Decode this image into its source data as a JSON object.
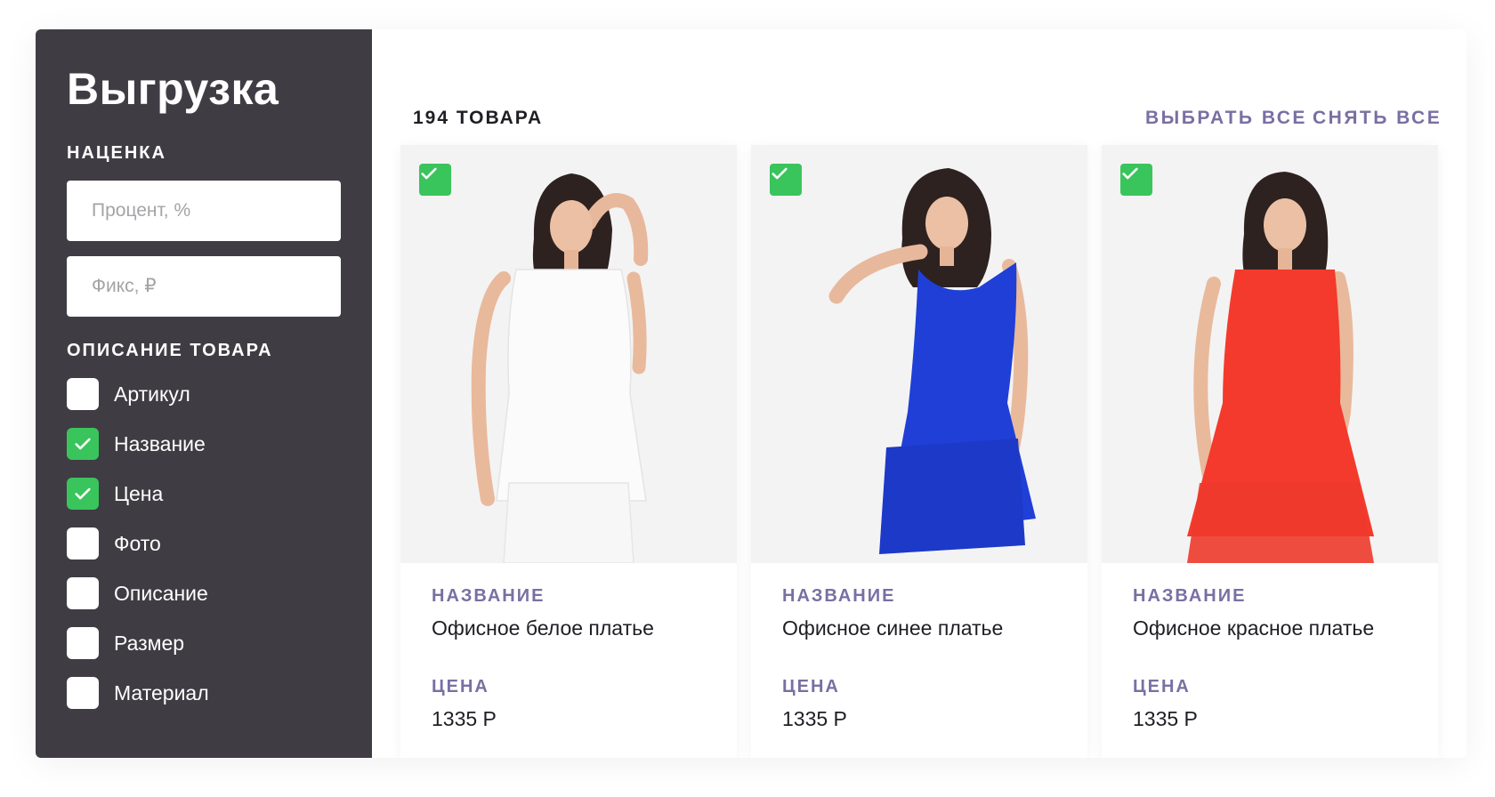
{
  "sidebar": {
    "title": "Выгрузка",
    "markup_label": "НАЦЕНКА",
    "percent_placeholder": "Процент, %",
    "fixed_placeholder": "Фикс, ₽",
    "description_label": "ОПИСАНИЕ ТОВАРА",
    "options": [
      {
        "label": "Артикул",
        "checked": false
      },
      {
        "label": "Название",
        "checked": true
      },
      {
        "label": "Цена",
        "checked": true
      },
      {
        "label": "Фото",
        "checked": false
      },
      {
        "label": "Описание",
        "checked": false
      },
      {
        "label": "Размер",
        "checked": false
      },
      {
        "label": "Материал",
        "checked": false
      }
    ]
  },
  "header": {
    "count": "194 ТОВАРА",
    "select_all": "ВЫБРАТЬ ВСЕ",
    "deselect_all": "СНЯТЬ ВСЕ"
  },
  "products": [
    {
      "name_label": "НАЗВАНИЕ",
      "name": "Офисное белое платье",
      "price_label": "ЦЕНА",
      "price": "1335 Р",
      "selected": true,
      "dress_color": "#fbfbfb"
    },
    {
      "name_label": "НАЗВАНИЕ",
      "name": "Офисное синее платье",
      "price_label": "ЦЕНА",
      "price": "1335 Р",
      "selected": true,
      "dress_color": "#1f3fd6"
    },
    {
      "name_label": "НАЗВАНИЕ",
      "name": "Офисное красное платье",
      "price_label": "ЦЕНА",
      "price": "1335 Р",
      "selected": true,
      "dress_color": "#f43a2c"
    }
  ],
  "colors": {
    "sidebar_bg": "#403c44",
    "accent_green": "#3ac45c",
    "label_purple": "#7a6fa3"
  },
  "icons": {
    "checkbox_checked": "check-icon"
  }
}
